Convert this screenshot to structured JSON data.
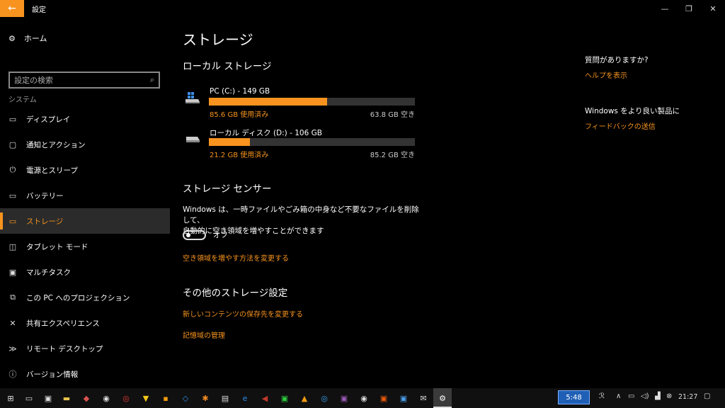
{
  "window": {
    "title": "設定",
    "back_icon": "back-arrow-icon",
    "minimize_icon": "minimize-icon",
    "restore_icon": "restore-icon",
    "close_icon": "close-icon"
  },
  "sidebar": {
    "home_label": "ホーム",
    "search_placeholder": "設定の検索",
    "section": "システム",
    "items": [
      {
        "label": "ディスプレイ",
        "icon": "display-icon"
      },
      {
        "label": "通知とアクション",
        "icon": "notification-icon"
      },
      {
        "label": "電源とスリープ",
        "icon": "power-icon"
      },
      {
        "label": "バッテリー",
        "icon": "battery-icon"
      },
      {
        "label": "ストレージ",
        "icon": "storage-icon",
        "active": true
      },
      {
        "label": "タブレット モード",
        "icon": "tablet-mode-icon"
      },
      {
        "label": "マルチタスク",
        "icon": "multitask-icon"
      },
      {
        "label": "この PC へのプロジェクション",
        "icon": "projection-icon"
      },
      {
        "label": "共有エクスペリエンス",
        "icon": "shared-experience-icon"
      },
      {
        "label": "リモート デスクトップ",
        "icon": "remote-desktop-icon"
      },
      {
        "label": "バージョン情報",
        "icon": "info-icon"
      }
    ]
  },
  "main": {
    "title": "ストレージ",
    "local_storage_heading": "ローカル ストレージ",
    "drives": [
      {
        "name": "PC (C:) - 149 GB",
        "used": "85.6 GB 使用済み",
        "free": "63.8 GB 空き",
        "used_fraction": 0.574,
        "icon": "system-drive-icon"
      },
      {
        "name": "ローカル ディスク (D:) - 106 GB",
        "used": "21.2 GB 使用済み",
        "free": "85.2 GB 空き",
        "used_fraction": 0.2,
        "icon": "disk-drive-icon"
      }
    ],
    "sense_heading": "ストレージ センサー",
    "sense_desc_line1": "Windows は、一時ファイルやごみ箱の中身など不要なファイルを削除して、",
    "sense_desc_line2": "自動的に空き領域を増やすことができます",
    "toggle_state": "オフ",
    "change_link": "空き領域を増やす方法を変更する",
    "other_heading": "その他のストレージ設定",
    "new_content_link": "新しいコンテンツの保存先を変更する",
    "manage_spaces_link": "記憶域の管理"
  },
  "aside": {
    "question": "質問がありますか?",
    "help_link": "ヘルプを表示",
    "feedback_text": "Windows をより良い製品に",
    "feedback_link": "フィードバックの送信"
  },
  "taskbar": {
    "battery_time": "5:48",
    "clock": "21:27",
    "accent": "#f7931e"
  }
}
